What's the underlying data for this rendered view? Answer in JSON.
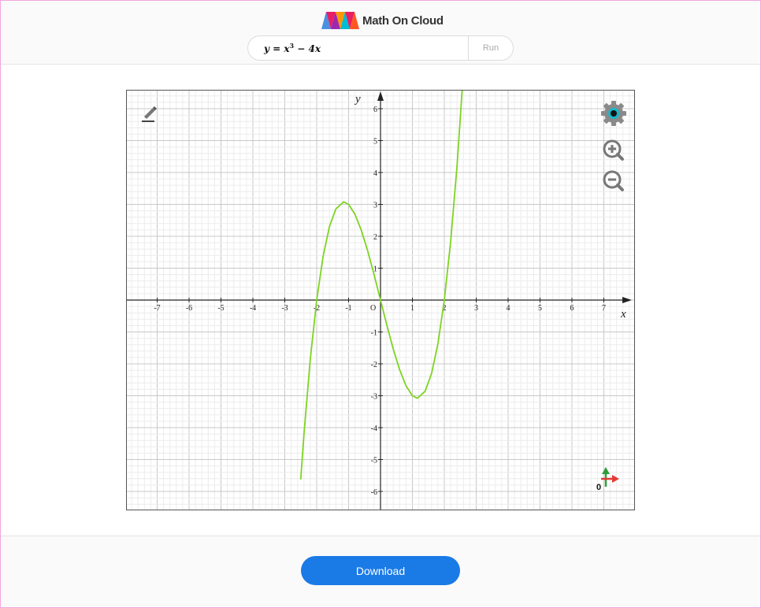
{
  "app": {
    "brand_name": "Math On Cloud"
  },
  "formula_bar": {
    "expression_prefix": "y = x",
    "expression_exponent": "3",
    "expression_suffix": " − 4x",
    "run_label": "Run"
  },
  "graph_tools": {
    "pencil_icon": "pencil-icon",
    "settings_icon": "gear-icon",
    "zoom_in_icon": "zoom-in-icon",
    "zoom_out_icon": "zoom-out-icon",
    "axes_widget_label": "0"
  },
  "footer": {
    "download_label": "Download"
  },
  "colors": {
    "curve": "#7ed321",
    "download": "#1a7ae6",
    "accent_red": "#e53935",
    "accent_green": "#2e9e3a"
  },
  "chart_data": {
    "type": "line",
    "function": "y = x^3 - 4x",
    "xlabel": "x",
    "ylabel": "y",
    "origin_label": "O",
    "xlim": [
      -7.9,
      8.0
    ],
    "ylim": [
      -6.6,
      6.6
    ],
    "x_ticks": [
      -7,
      -6,
      -5,
      -4,
      -3,
      -2,
      -1,
      1,
      2,
      3,
      4,
      5,
      6,
      7
    ],
    "y_ticks": [
      -6,
      -5,
      -4,
      -3,
      -2,
      -1,
      1,
      2,
      3,
      4,
      5,
      6
    ],
    "grid": true,
    "series": [
      {
        "x": [
          -2.5,
          -2.4,
          -2.2,
          -2.0,
          -1.8,
          -1.6,
          -1.4,
          -1.155,
          -1.0,
          -0.8,
          -0.6,
          -0.4,
          -0.2,
          0.0,
          0.2,
          0.4,
          0.6,
          0.8,
          1.0,
          1.155,
          1.4,
          1.6,
          1.8,
          2.0,
          2.2,
          2.4,
          2.6
        ],
        "y": [
          -5.625,
          -4.224,
          -1.848,
          0.0,
          1.368,
          2.304,
          2.856,
          3.079,
          3.0,
          2.688,
          2.184,
          1.536,
          0.792,
          0.0,
          -0.792,
          -1.536,
          -2.184,
          -2.688,
          -3.0,
          -3.079,
          -2.856,
          -2.304,
          -1.368,
          0.0,
          1.848,
          4.224,
          7.176
        ]
      }
    ]
  }
}
